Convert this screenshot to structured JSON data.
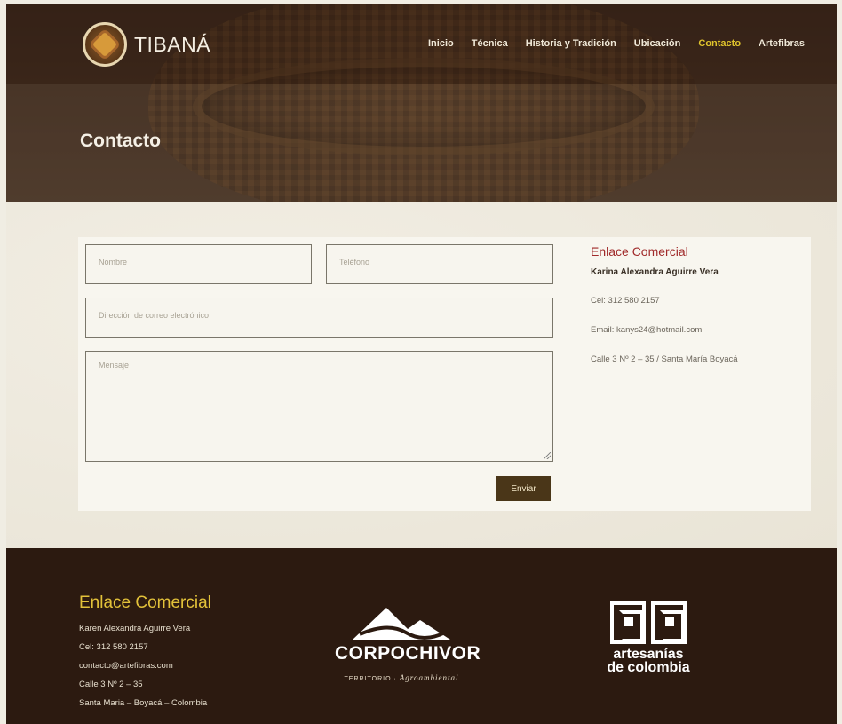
{
  "brand": {
    "name": "TIBANÁ"
  },
  "nav": {
    "items": [
      {
        "label": "Inicio",
        "active": false
      },
      {
        "label": "Técnica",
        "active": false
      },
      {
        "label": "Historia y Tradición",
        "active": false
      },
      {
        "label": "Ubicación",
        "active": false
      },
      {
        "label": "Contacto",
        "active": true
      },
      {
        "label": "Artefibras",
        "active": false
      }
    ]
  },
  "page": {
    "title": "Contacto"
  },
  "form": {
    "name_placeholder": "Nombre",
    "phone_placeholder": "Teléfono",
    "email_placeholder": "Dirección de correo electrónico",
    "message_placeholder": "Mensaje",
    "submit_label": "Enviar"
  },
  "contact_info": {
    "heading": "Enlace Comercial",
    "person": "Karina Alexandra Aguirre Vera",
    "phone": "Cel: 312 580 2157",
    "email": "Email: kanys24@hotmail.com",
    "address": "Calle 3 Nº 2 – 35  / Santa María Boyacá"
  },
  "footer": {
    "heading": "Enlace Comercial",
    "lines": [
      "Karen Alexandra Aguirre Vera",
      "Cel: 312 580 2157",
      "contacto@artefibras.com",
      "Calle 3 Nº 2 – 35",
      "Santa Maria – Boyacá – Colombia"
    ],
    "corpochivor": {
      "name": "CORPOCHIVOR",
      "tag_prefix": "TERRITORIO ·",
      "tag_script": "Agroambiental"
    },
    "artesanias": {
      "line1": "artesanías",
      "line2": "de colombia"
    }
  },
  "colors": {
    "accent_active": "#e0c42c",
    "heading_red": "#a02a2a",
    "footer_bg": "#2c1a10",
    "button_bg": "#4a3618"
  }
}
